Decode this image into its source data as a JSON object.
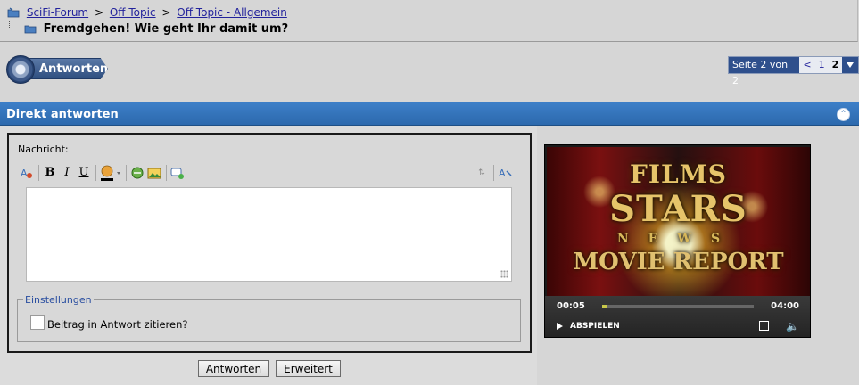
{
  "breadcrumb": {
    "items": [
      "SciFi-Forum",
      "Off Topic",
      "Off Topic - Allgemein"
    ],
    "separator": ">"
  },
  "thread": {
    "title": "Fremdgehen! Wie geht Ihr damit um?"
  },
  "reply_button": {
    "label": "Antworten"
  },
  "pagination": {
    "label": "Seite 2 von 2",
    "prev": "<",
    "pages": [
      "1",
      "2"
    ],
    "current": "2"
  },
  "quick_reply": {
    "title": "Direkt antworten",
    "message_label": "Nachricht:",
    "settings": {
      "legend": "Einstellungen",
      "quote_label": "Beitrag in Antwort zitieren?",
      "quote_checked": false
    },
    "submit_label": "Antworten",
    "advanced_label": "Erweitert"
  },
  "toolbar": {
    "bold": "B",
    "italic": "I",
    "underline": "U"
  },
  "video": {
    "title_line1": "FILMS",
    "title_line2": "STARS",
    "title_line3": "NEWS",
    "title_line4": "MOVIE REPORT",
    "current_time": "00:05",
    "duration": "04:00",
    "progress_fraction": 0.02,
    "play_label": "ABSPIELEN"
  },
  "colors": {
    "panel_header": "#2c69ad",
    "pager_accent": "#2e4f8c",
    "link": "#22229c"
  }
}
